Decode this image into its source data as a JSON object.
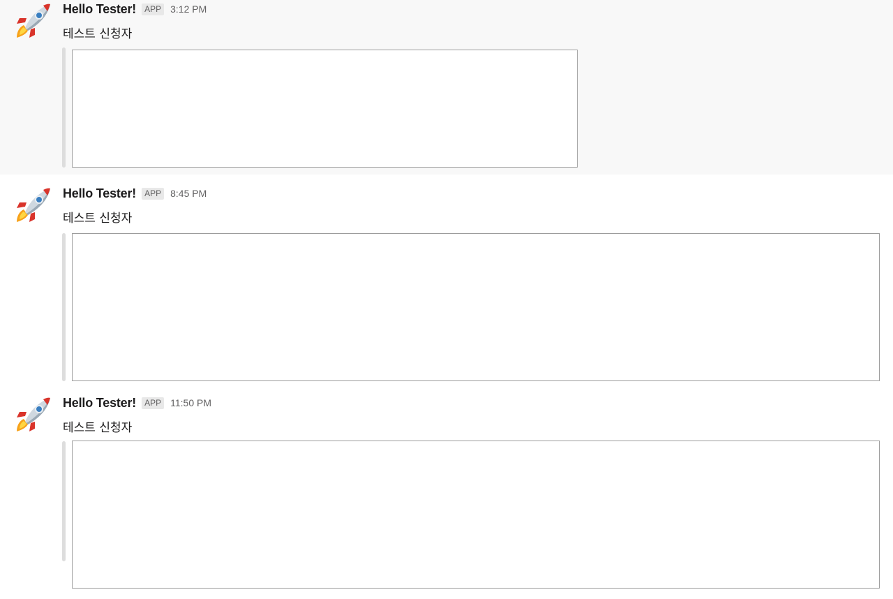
{
  "messages": [
    {
      "sender": "Hello Tester!",
      "badge": "APP",
      "time": "3:12 PM",
      "text": "테스트 신청자",
      "avatar_icon": "rocket-icon"
    },
    {
      "sender": "Hello Tester!",
      "badge": "APP",
      "time": "8:45 PM",
      "text": "테스트 신청자",
      "avatar_icon": "rocket-icon"
    },
    {
      "sender": "Hello Tester!",
      "badge": "APP",
      "time": "11:50 PM",
      "text": "테스트 신청자",
      "avatar_icon": "rocket-icon"
    }
  ],
  "colors": {
    "hover_background": "#f8f8f8",
    "badge_background": "#e8e8e8",
    "attachment_bar": "#dddddd",
    "frame_border": "#9c9c9c"
  }
}
